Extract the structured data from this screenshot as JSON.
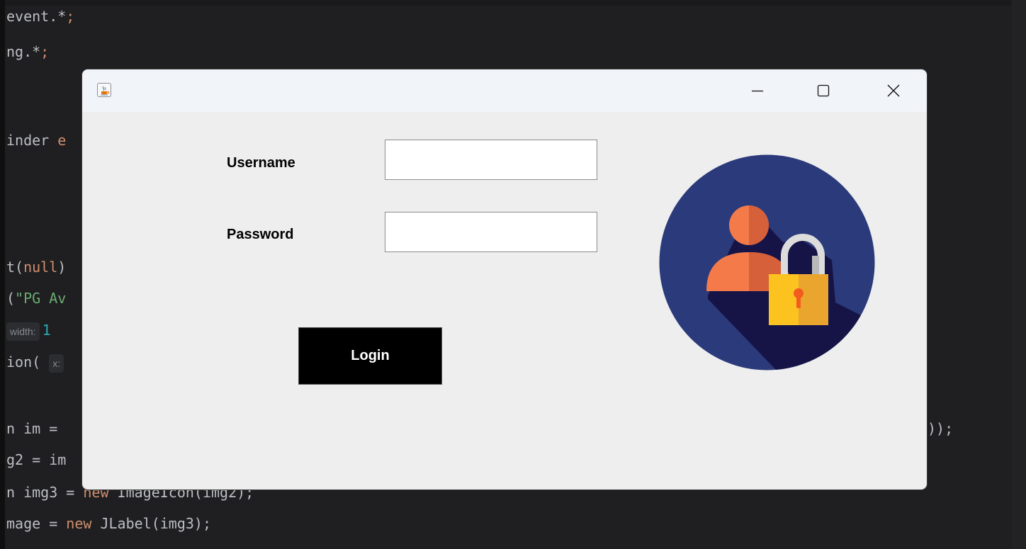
{
  "ide": {
    "lines": [
      {
        "plain": "event.*",
        "kw": ";"
      },
      {
        "plain": "ng.*",
        "kw": ";"
      },
      {
        "plain": "inder ",
        "kw": "e"
      },
      {
        "plain": "t(",
        "kw": "null",
        "tail": ")"
      },
      {
        "plain": "(",
        "str": "\"PG Av"
      },
      {
        "hint": "width:",
        "num": "1"
      },
      {
        "plain": "ion(",
        "hint": "x:"
      },
      {
        "plain": "n im =",
        "right": "));"
      },
      {
        "plain": "g2 = im"
      },
      {
        "plain": "n img3 = ",
        "kw": "new",
        "tail": " ImageIcon(img2);"
      },
      {
        "plain": "mage = ",
        "kw": "new",
        "tail": " JLabel(img3);"
      }
    ]
  },
  "window": {
    "icon": "java-cup-icon",
    "controls": [
      "minimize-icon",
      "maximize-icon",
      "close-icon"
    ]
  },
  "form": {
    "username_label": "Username",
    "username_value": "",
    "password_label": "Password",
    "password_value": "",
    "login_label": "Login"
  },
  "image": {
    "icon": "user-lock-icon",
    "colors": {
      "circle": "#2b3a7a",
      "shadow": "#161447",
      "person": "#f47a4a",
      "lock_body": "#fcc21f",
      "lock_shackle": "#dcdcdc",
      "keyhole": "#f25c1f"
    }
  }
}
